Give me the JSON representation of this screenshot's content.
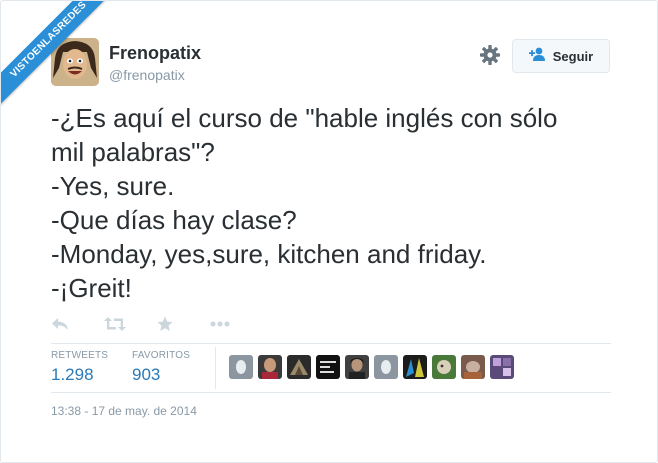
{
  "watermark": "VISTOENLASREDES",
  "author": {
    "name": "Frenopatix",
    "handle": "@frenopatix"
  },
  "follow_button": {
    "label": "Seguir"
  },
  "tweet": {
    "lines": [
      "-¿Es aquí el curso de \"hable inglés con sólo",
      "mil palabras\"?",
      "-Yes, sure.",
      "-Que días hay clase?",
      "-Monday, yes,sure, kitchen and friday.",
      "-¡Greit!"
    ]
  },
  "stats": {
    "retweets_label": "RETWEETS",
    "retweets_value": "1.298",
    "favorites_label": "FAVORITOS",
    "favorites_value": "903"
  },
  "timestamp": "13:38 - 17 de may. de 2014",
  "colors": {
    "link_blue": "#2a7ab8",
    "ribbon": "#2a8fd6",
    "muted": "#8899a6"
  },
  "icons": [
    "gear-icon",
    "add-user-icon",
    "reply-icon",
    "retweet-icon",
    "favorite-icon",
    "more-icon"
  ]
}
